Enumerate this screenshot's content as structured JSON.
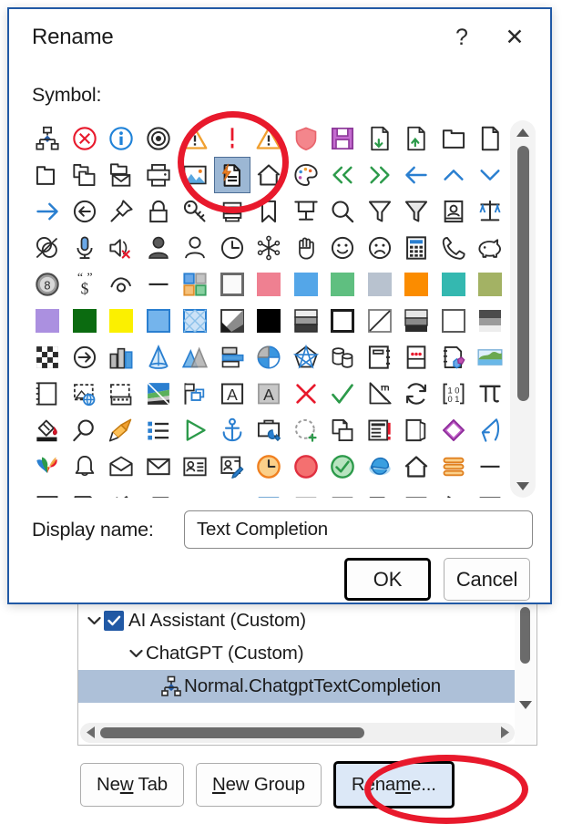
{
  "dialog": {
    "title": "Rename",
    "help_button": "?",
    "close_button": "✕",
    "symbol_label": "Symbol:",
    "display_name_label": "Display name:",
    "display_name_value": "Text Completion",
    "ok_label": "OK",
    "cancel_label": "Cancel",
    "accent_color": "#2159a5",
    "selection_color": "#9cb7d4"
  },
  "symbol_grid": {
    "selected_index": 18,
    "selected_icon": "document-lightning-icon",
    "rows": [
      [
        "org-chart-icon",
        "cancel-circle-icon",
        "info-circle-icon",
        "target-icon",
        "warning-triangle-icon",
        "warning-exclamation-icon",
        "warning-triangle-icon",
        "shield-icon",
        "save-disk-icon",
        "document-down-icon",
        "document-up-icon",
        "folder-icon",
        "page-icon"
      ],
      [
        "folder-open-icon",
        "folders-icon",
        "folder-mail-icon",
        "printer-icon",
        "picture-icon",
        "document-lightning-icon",
        "home-outline-icon",
        "palette-icon",
        "double-arrow-left-icon",
        "double-arrow-right-icon",
        "arrow-left-icon",
        "chevron-up-icon",
        "chevron-down-icon"
      ],
      [
        "arrow-right-icon",
        "back-circle-icon",
        "pushpin-icon",
        "lock-icon",
        "key-icon",
        "scroll-icon",
        "bookmark-icon",
        "projector-icon",
        "magnifier-icon",
        "funnel-outline-icon",
        "funnel-icon",
        "id-card-icon",
        "scales-icon"
      ],
      [
        "venn-icon",
        "microphone-icon",
        "mute-icon",
        "person-filled-icon",
        "person-outline-icon",
        "clock-icon",
        "snowflake-icon",
        "hand-icon",
        "smiley-happy-icon",
        "smiley-sad-icon",
        "calculator-icon",
        "phone-icon",
        "piggybank-icon"
      ],
      [
        "eight-ball-icon",
        "quote-dollar-icon",
        "eye-icon",
        "dash-icon",
        "color-squares-icon",
        "swatch-white-icon",
        "swatch-pink-icon",
        "swatch-blue-icon",
        "swatch-green-icon",
        "swatch-gray-blue-icon",
        "swatch-orange-icon",
        "swatch-teal-icon",
        "swatch-olive-icon"
      ],
      [
        "swatch-purple-icon",
        "swatch-dark-green-icon",
        "swatch-yellow-icon",
        "swatch-light-blue-icon",
        "swatch-pattern-icon",
        "fill-diagonal-icon",
        "swatch-black-icon",
        "gradient-gray-icon",
        "outline-thick-icon",
        "diagonal-line-icon",
        "gradient-bars-icon",
        "swatch-empty-icon",
        "gradient-dark-icon"
      ],
      [
        "checkerboard-icon",
        "arrow-circle-icon",
        "bar-chart-icon",
        "cone-icon",
        "area-chart-icon",
        "bar-horizontal-icon",
        "pie-chart-icon",
        "radar-chart-icon",
        "cylinders-icon",
        "notebook-icon",
        "menu-dots-icon",
        "shapes-icon",
        "landscape-icon"
      ],
      [
        "page-break-icon",
        "web-image-icon",
        "film-icon",
        "color-fill-icon",
        "flag-shape-icon",
        "letter-a-box-icon",
        "letter-a-shaded-icon",
        "red-x-icon",
        "green-check-icon",
        "ruler-icon",
        "refresh-icon",
        "binary-icon",
        "pi-icon"
      ],
      [
        "paint-bucket-icon",
        "magnify-icon",
        "brush-icon",
        "bullet-list-icon",
        "play-icon",
        "anchor-icon",
        "toolbox-icon",
        "add-shape-icon",
        "copy-icon",
        "list-alert-icon",
        "book-icon",
        "eraser-icon",
        "pen-script-icon"
      ],
      [
        "butterfly-icon",
        "bell-icon",
        "mail-open-icon",
        "mail-closed-icon",
        "contact-card-icon",
        "contact-edit-icon",
        "clock-orange-icon",
        "circle-red-icon",
        "check-circle-green-icon",
        "browser-icon",
        "home-icon",
        "stacked-lines-icon",
        "minus-icon"
      ],
      [
        "shape-a-icon",
        "shape-b-icon",
        "shape-c-icon",
        "shape-d-icon",
        "shape-e-icon",
        "blank-icon",
        "header-blue-icon",
        "header-gray-icon",
        "header-dark-icon",
        "corner-icon",
        "table-icon",
        "cursor-icon",
        "footer-icon"
      ]
    ]
  },
  "background_panel": {
    "tree": [
      {
        "label": "AI Assistant (Custom)",
        "level": 1,
        "expanded": true,
        "checked": true,
        "selected": false
      },
      {
        "label": "ChatGPT (Custom)",
        "level": 2,
        "expanded": true,
        "checked": false,
        "selected": false
      },
      {
        "label": "Normal.ChatgptTextCompletion",
        "level": 3,
        "expanded": false,
        "checked": false,
        "selected": true
      }
    ],
    "buttons": [
      {
        "pre": "Ne",
        "key": "w",
        "post": " Tab",
        "name": "new-tab-button",
        "focused": false
      },
      {
        "pre": "",
        "key": "N",
        "post": "ew Group",
        "name": "new-group-button",
        "focused": false
      },
      {
        "pre": "Rena",
        "key": "m",
        "post": "e...",
        "name": "rename-button",
        "focused": true
      }
    ]
  },
  "annotations": [
    {
      "name": "annotation-circle-symbol",
      "target": "document-lightning-icon",
      "color": "#e8192c"
    },
    {
      "name": "annotation-circle-rename",
      "target": "rename-button",
      "color": "#e8192c"
    }
  ]
}
